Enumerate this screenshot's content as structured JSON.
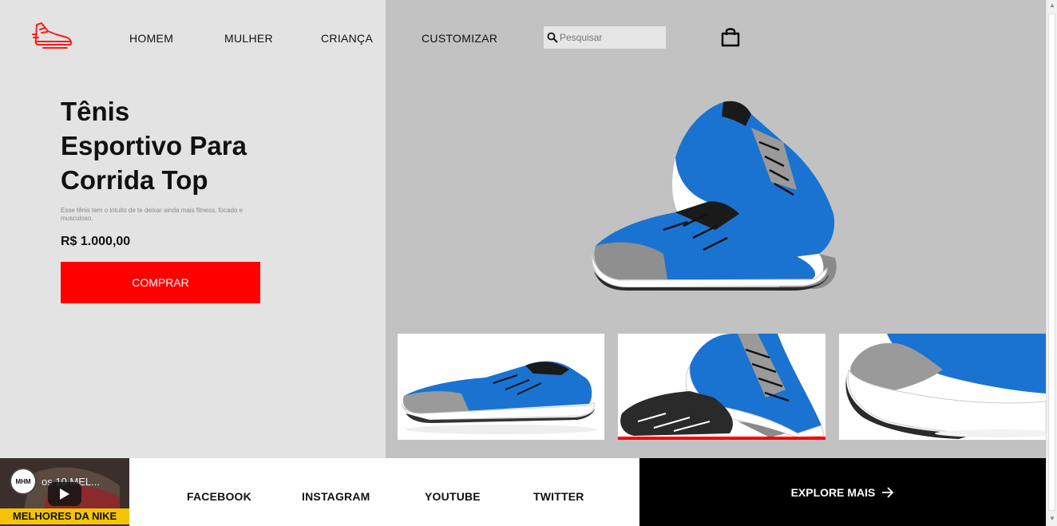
{
  "nav": {
    "logo": "shoe-logo-icon",
    "items": [
      "HOMEM",
      "MULHER",
      "CRIANÇA",
      "CUSTOMIZAR"
    ],
    "search_placeholder": "Pesquisar",
    "cart_icon": "shopping-bag-icon"
  },
  "product": {
    "title_line1": "Tênis",
    "title_line2": "Esportivo Para",
    "title_line3": "Corrida Top",
    "description": "Esse tênis tem o intuito de te deixar ainda mais fitness, focado e musculoso.",
    "price": "R$ 1.000,00",
    "buy_label": "COMPRAR"
  },
  "gallery": {
    "active_index": 1,
    "thumbnail_count": 3
  },
  "footer": {
    "video": {
      "channel_badge": "MHM",
      "title": "os 10 MEL...",
      "banner": "MELHORES DA NIKE"
    },
    "links": [
      "FACEBOOK",
      "INSTAGRAM",
      "YOUTUBE",
      "TWITTER"
    ],
    "explore_label": "EXPLORE MAIS"
  },
  "colors": {
    "accent": "#ff0000",
    "left_bg": "#e3e3e3",
    "right_bg": "#c2c2c2",
    "shoe_blue": "#1a73d1"
  }
}
